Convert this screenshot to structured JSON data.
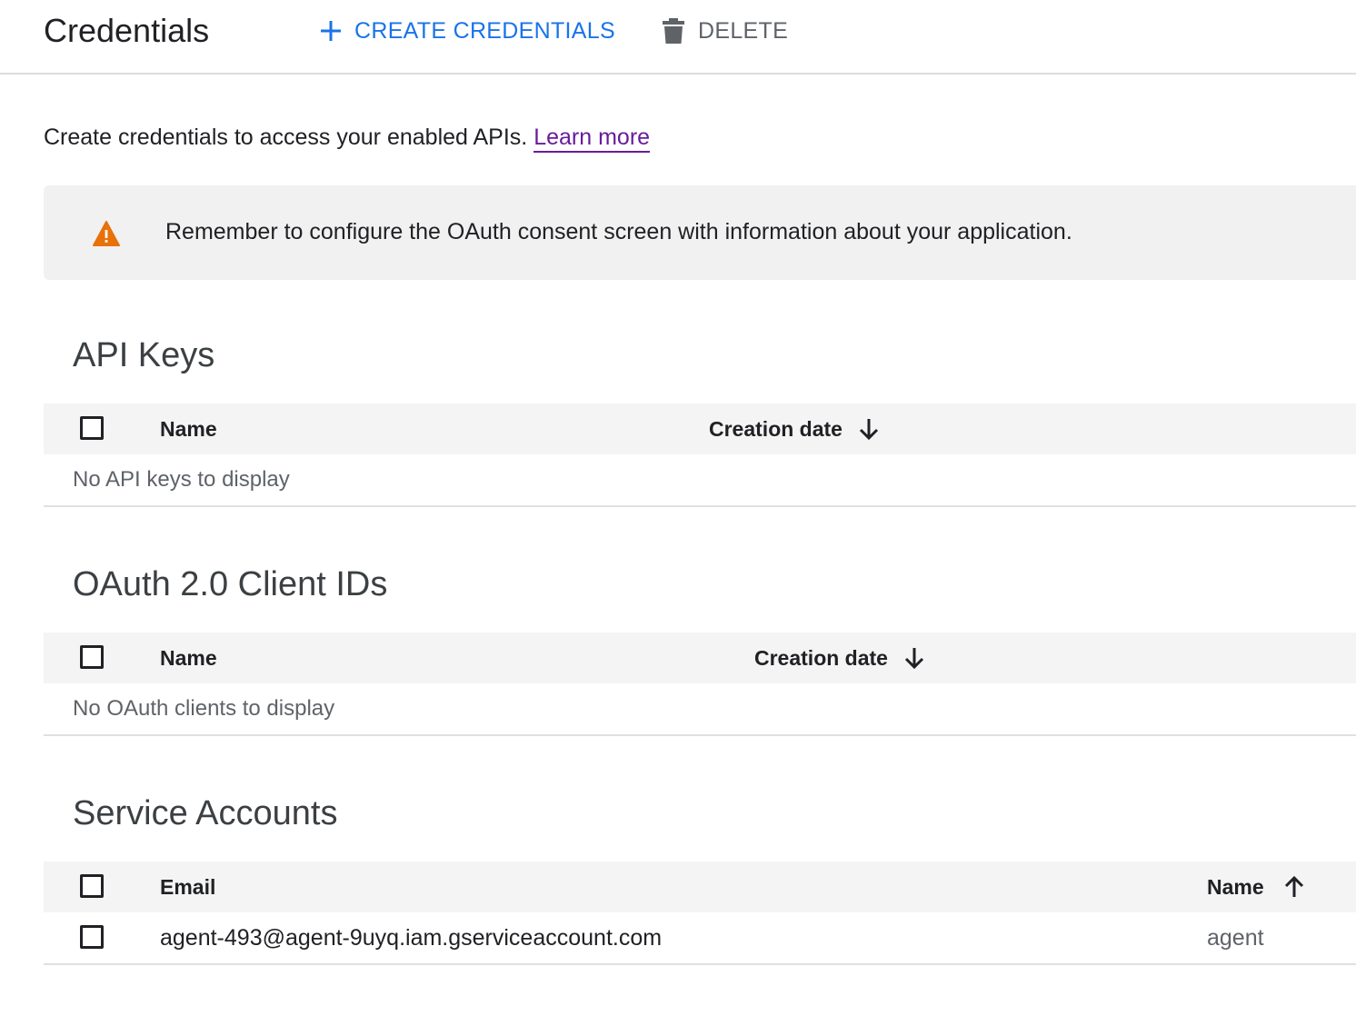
{
  "header": {
    "title": "Credentials",
    "create_label": "CREATE CREDENTIALS",
    "delete_label": "DELETE"
  },
  "intro": {
    "text": "Create credentials to access your enabled APIs.",
    "link": "Learn more"
  },
  "banner": {
    "icon": "warning-icon",
    "text": "Remember to configure the OAuth consent screen with information about your application."
  },
  "api_keys": {
    "title": "API Keys",
    "columns": [
      "Name",
      "Creation date"
    ],
    "sort": "descending",
    "empty_text": "No API keys to display"
  },
  "oauth": {
    "title": "OAuth 2.0 Client IDs",
    "columns": [
      "Name",
      "Creation date"
    ],
    "sort": "descending",
    "empty_text": "No OAuth clients to display"
  },
  "service_accounts": {
    "title": "Service Accounts",
    "columns": [
      "Email",
      "Name"
    ],
    "sort": "ascending",
    "rows": [
      {
        "email": "agent-493@agent-9uyq.iam.gserviceaccount.com",
        "name": "agent"
      }
    ]
  },
  "colors": {
    "accent": "#1a73e8",
    "warning": "#e8710a",
    "link_visited": "#6a1b9a"
  }
}
